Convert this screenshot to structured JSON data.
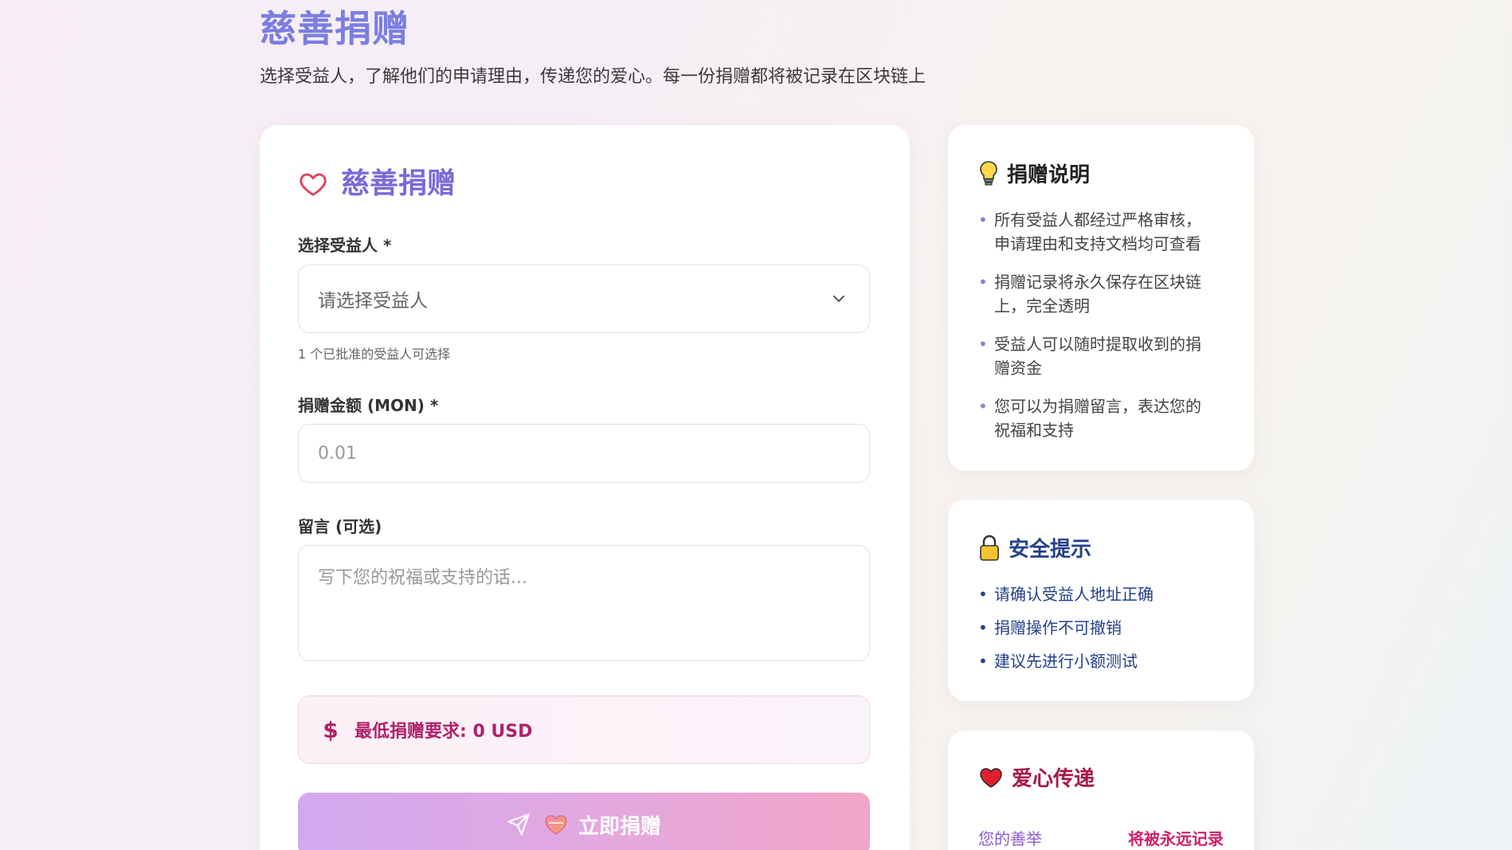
{
  "header": {
    "title": "慈善捐赠",
    "subtitle": "选择受益人，了解他们的申请理由，传递您的爱心。每一份捐赠都将被记录在区块链上"
  },
  "form": {
    "title": "慈善捐赠",
    "beneficiary_label": "选择受益人 *",
    "beneficiary_placeholder": "请选择受益人",
    "beneficiary_hint": "1 个已批准的受益人可选择",
    "amount_label": "捐赠金额 (MON) *",
    "amount_placeholder": "0.01",
    "message_label": "留言 (可选)",
    "message_placeholder": "写下您的祝福或支持的话...",
    "min_requirement": "最低捐赠要求: 0 USD",
    "submit_label": "立即捐赠"
  },
  "info_card": {
    "title": "捐赠说明",
    "items": [
      "所有受益人都经过严格审核，申请理由和支持文档均可查看",
      "捐赠记录将永久保存在区块链上，完全透明",
      "受益人可以随时提取收到的捐赠资金",
      "您可以为捐赠留言，表达您的祝福和支持"
    ]
  },
  "security_card": {
    "title": "安全提示",
    "items": [
      "请确认受益人地址正确",
      "捐赠操作不可撤销",
      "建议先进行小额测试"
    ]
  },
  "love_card": {
    "title": "爱心传递",
    "left_text": "您的善举",
    "right_text": "将被永远记录"
  },
  "colors": {
    "accent_purple": "#7a6ad8",
    "title_blue": "#7b7ee0",
    "pink": "#b0206a",
    "navy": "#24408a"
  },
  "icons": {
    "form_title": "heart-outline-icon",
    "select": "chevron-down-icon",
    "min_box": "dollar-icon",
    "submit": [
      "send-icon",
      "heart-icon"
    ],
    "info": "lightbulb-icon",
    "security": "lock-icon",
    "love": "heart-icon"
  }
}
